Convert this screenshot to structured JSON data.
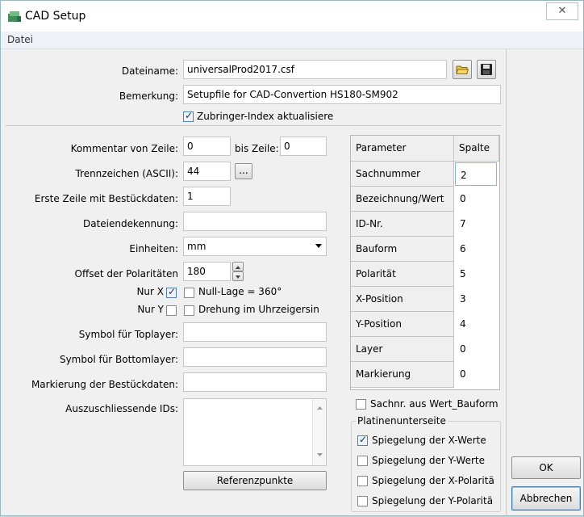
{
  "window": {
    "title": "CAD Setup",
    "close_glyph": "✕"
  },
  "menu": {
    "items": [
      "Datei"
    ]
  },
  "file": {
    "dateiname_label": "Dateiname:",
    "dateiname_value": "universalProd2017.csf",
    "bemerkung_label": "Bemerkung:",
    "bemerkung_value": "Setupfile for CAD-Convertion HS180-SM902",
    "zubringer_label": "Zubringer-Index aktualisiere",
    "zubringer_checked": true
  },
  "form": {
    "kommentar_label": "Kommentar von Zeile:",
    "kommentar_value": "0",
    "bis_label": "bis Zeile:",
    "bis_value": "0",
    "trenn_label": "Trennzeichen (ASCII):",
    "trenn_value": "44",
    "trenn_btn": "...",
    "erste_label": "Erste Zeile mit Bestückdaten:",
    "erste_value": "1",
    "dateiende_label": "Dateiendekennung:",
    "dateiende_value": "",
    "einheiten_label": "Einheiten:",
    "einheiten_value": "mm",
    "offset_label": "Offset der Polaritäten",
    "offset_value": "180",
    "nurx_label": "Nur X",
    "nurx_checked": true,
    "nulllage_label": "Null-Lage = 360°",
    "nulllage_checked": false,
    "nury_label": "Nur Y",
    "nury_checked": false,
    "drehung_label": "Drehung im Uhrzeigersin",
    "drehung_checked": false,
    "top_label": "Symbol für Toplayer:",
    "top_value": "",
    "bottom_label": "Symbol für Bottomlayer:",
    "bottom_value": "",
    "markierung_label": "Markierung der Bestückdaten:",
    "markierung_value": "",
    "ausz_label": "Auszuschliessende IDs:",
    "ausz_value": "",
    "referenz_btn": "Referenzpunkte"
  },
  "grid": {
    "header": {
      "param": "Parameter",
      "spalte": "Spalte"
    },
    "rows": [
      {
        "name": "Sachnummer",
        "value": "2"
      },
      {
        "name": "Bezeichnung/Wert",
        "value": "0"
      },
      {
        "name": "ID-Nr.",
        "value": "7"
      },
      {
        "name": "Bauform",
        "value": "6"
      },
      {
        "name": "Polarität",
        "value": "5"
      },
      {
        "name": "X-Position",
        "value": "3"
      },
      {
        "name": "Y-Position",
        "value": "4"
      },
      {
        "name": "Layer",
        "value": "0"
      },
      {
        "name": "Markierung",
        "value": "0"
      }
    ]
  },
  "options": {
    "sachnr_label": "Sachnr. aus Wert_Bauform",
    "sachnr_checked": false,
    "group_title": "Platinenunterseite",
    "spiegel_x_label": "Spiegelung der X-Werte",
    "spiegel_x_checked": true,
    "spiegel_y_label": "Spiegelung der Y-Werte",
    "spiegel_y_checked": false,
    "spiegel_xpol_label": "Spiegelung der X-Polaritä",
    "spiegel_xpol_checked": false,
    "spiegel_ypol_label": "Spiegelung der Y-Polaritä",
    "spiegel_ypol_checked": false
  },
  "buttons": {
    "ok": "OK",
    "cancel": "Abbrechen"
  }
}
